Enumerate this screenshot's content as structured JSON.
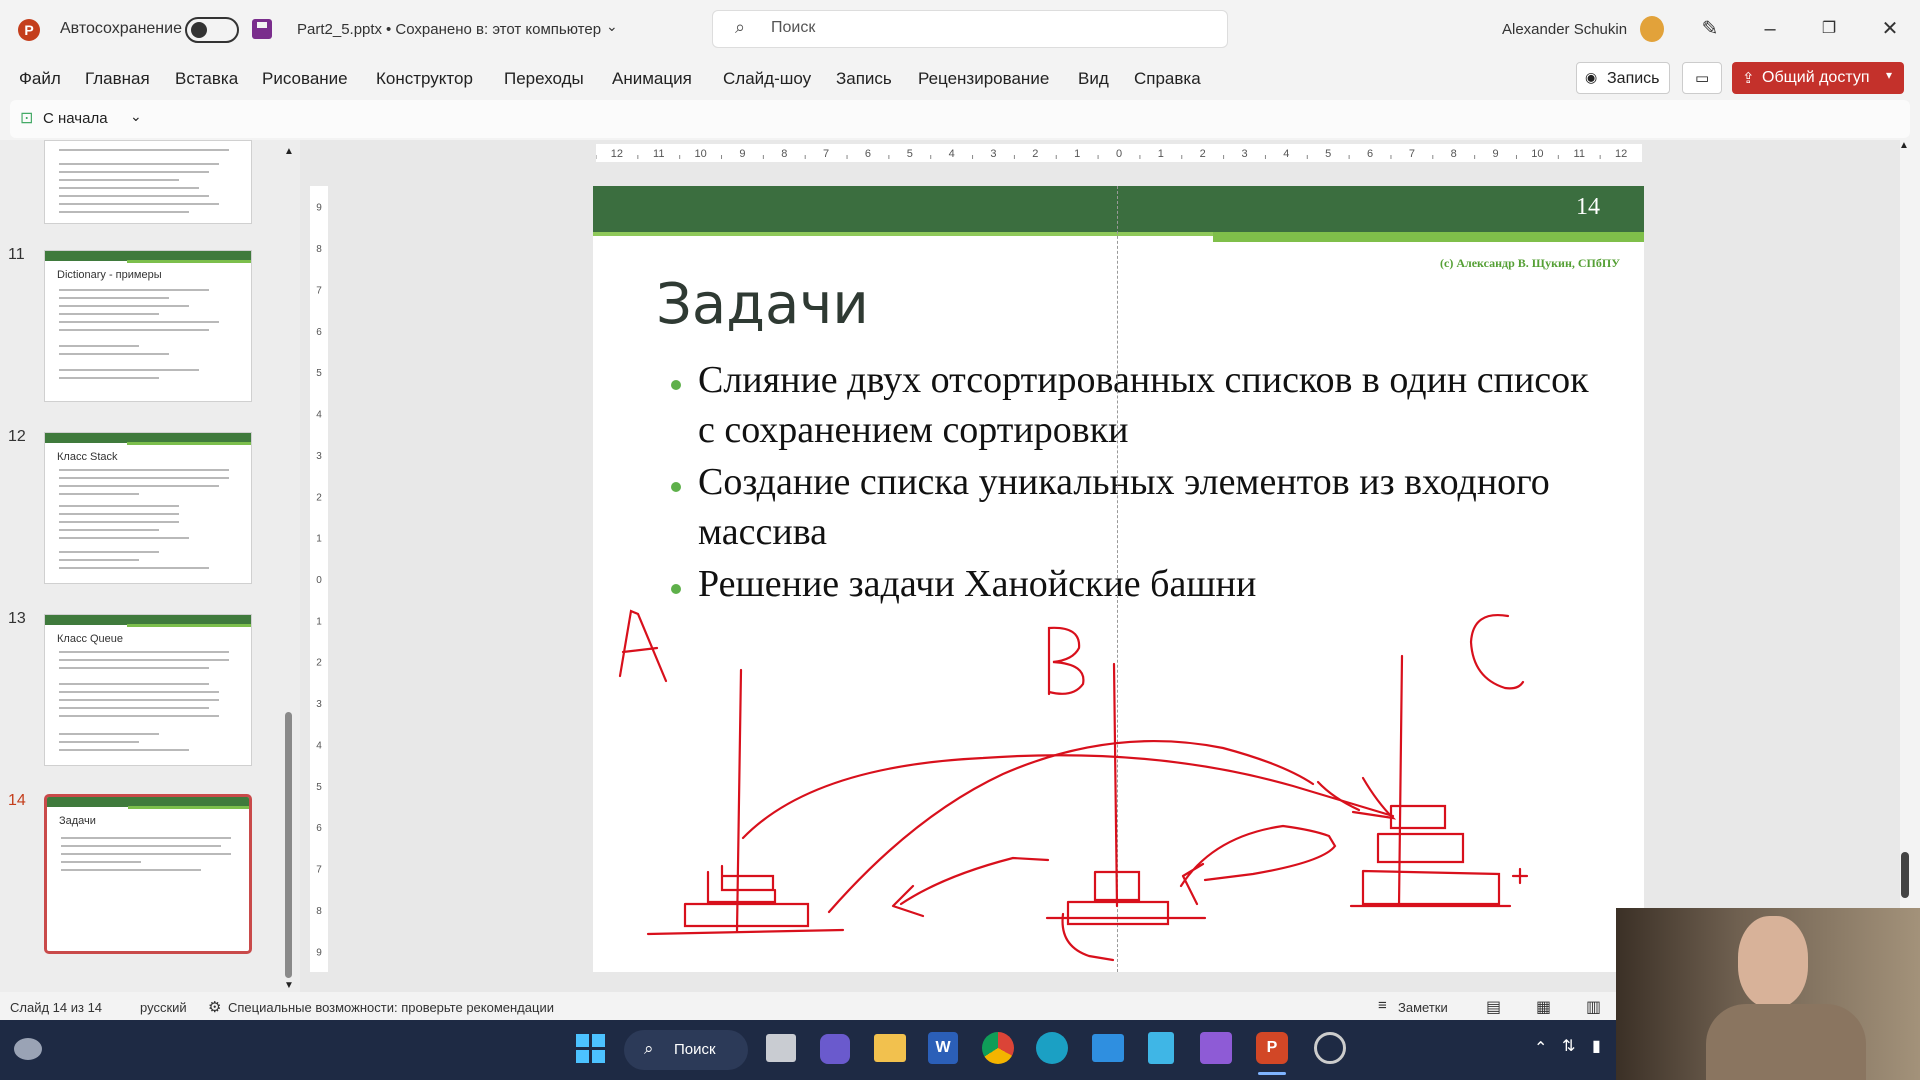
{
  "titlebar": {
    "autosave_label": "Автосохранение",
    "file_name": "Part2_5.pptx",
    "save_status": "• Сохранено в: этот компьютер",
    "search_placeholder": "Поиск",
    "user_name": "Alexander Schukin"
  },
  "menu": {
    "items": [
      "Файл",
      "Главная",
      "Вставка",
      "Рисование",
      "Конструктор",
      "Переходы",
      "Анимация",
      "Слайд-шоу",
      "Запись",
      "Рецензирование",
      "Вид",
      "Справка"
    ],
    "record_button": "Запись",
    "share_button": "Общий доступ"
  },
  "quickbar": {
    "from_start_label": "С начала"
  },
  "thumbnails": [
    {
      "number": "",
      "title": ""
    },
    {
      "number": "11",
      "title": "Dictionary - примеры"
    },
    {
      "number": "12",
      "title": "Класс Stack"
    },
    {
      "number": "13",
      "title": "Класс Queue"
    },
    {
      "number": "14",
      "title": "Задачи"
    }
  ],
  "slide": {
    "number": "14",
    "author": "(c) Александр В. Щукин, СПбПУ",
    "title": "Задачи",
    "bullets": [
      "Слияние двух отсортированных списков в один список с сохранением сортировки",
      "Создание списка уникальных элементов из входного массива",
      "Решение задачи Ханойские башни"
    ],
    "drawing_labels": [
      "A",
      "B",
      "C"
    ]
  },
  "rulers": {
    "horizontal_ticks": [
      "12",
      "11",
      "10",
      "9",
      "8",
      "7",
      "6",
      "5",
      "4",
      "3",
      "2",
      "1",
      "0",
      "1",
      "2",
      "3",
      "4",
      "5",
      "6",
      "7",
      "8",
      "9",
      "10",
      "11",
      "12"
    ],
    "vertical_ticks": [
      "9",
      "8",
      "7",
      "6",
      "5",
      "4",
      "3",
      "2",
      "1",
      "0",
      "1",
      "2",
      "3",
      "4",
      "5",
      "6",
      "7",
      "8",
      "9"
    ]
  },
  "statusbar": {
    "slide_info": "Слайд 14 из 14",
    "language": "русский",
    "accessibility": "Специальные возможности: проверьте рекомендации",
    "notes": "Заметки"
  },
  "taskbar": {
    "search_label": "Поиск"
  },
  "colors": {
    "accent_red": "#c4312b",
    "slide_green": "#3b6e3f",
    "ink_red": "#d8101c"
  }
}
